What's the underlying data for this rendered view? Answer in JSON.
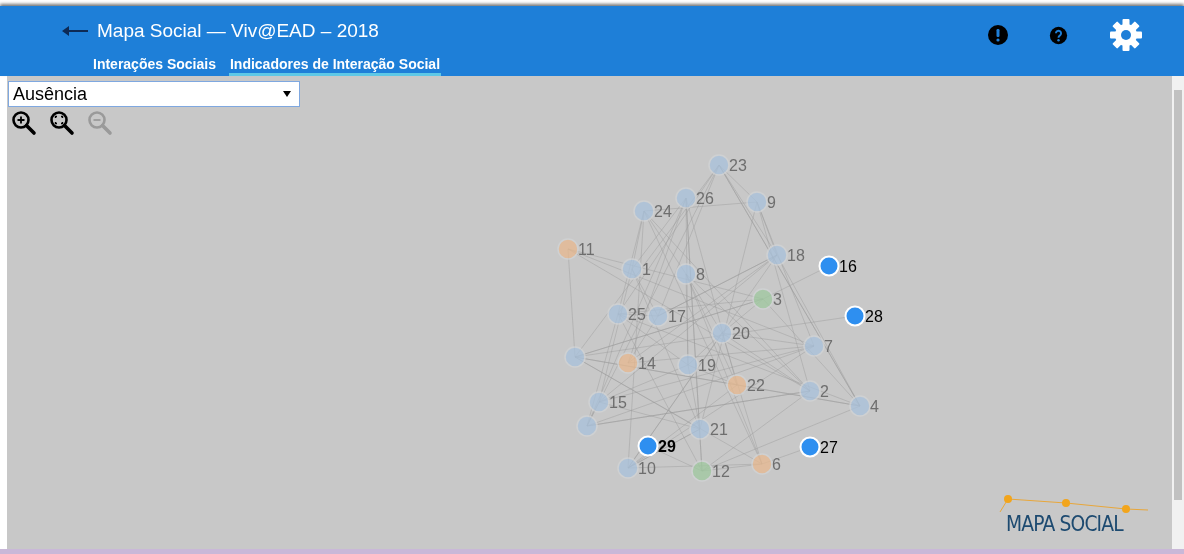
{
  "header": {
    "title": "Mapa Social — Viv@EAD – 2018"
  },
  "tabs": [
    {
      "label": "Interações Sociais",
      "selected": false
    },
    {
      "label": "Indicadores de Interação Social",
      "selected": true
    }
  ],
  "indicator_select": {
    "value": "Ausência"
  },
  "zoom_tools": [
    {
      "kind": "in",
      "disabled": false
    },
    {
      "kind": "reset",
      "disabled": false
    },
    {
      "kind": "out",
      "disabled": true
    }
  ],
  "graph": {
    "nodes": [
      {
        "label": "23",
        "color": "#a9c2dc",
        "highlighted": false
      },
      {
        "label": "26",
        "color": "#a9c2dc",
        "highlighted": false
      },
      {
        "label": "9",
        "color": "#a9c2dc",
        "highlighted": false
      },
      {
        "label": "24",
        "color": "#a9c2dc",
        "highlighted": false
      },
      {
        "label": "11",
        "color": "#e8b98f",
        "highlighted": false
      },
      {
        "label": "18",
        "color": "#a9c2dc",
        "highlighted": false
      },
      {
        "label": "16",
        "color": "#2e8ff0",
        "highlighted": true
      },
      {
        "label": "1",
        "color": "#a9c2dc",
        "highlighted": false
      },
      {
        "label": "8",
        "color": "#a9c2dc",
        "highlighted": false
      },
      {
        "label": "3",
        "color": "#9fc99f",
        "highlighted": false
      },
      {
        "label": "25",
        "color": "#a9c2dc",
        "highlighted": false
      },
      {
        "label": "17",
        "color": "#a9c2dc",
        "highlighted": false
      },
      {
        "label": "28",
        "color": "#2e8ff0",
        "highlighted": true
      },
      {
        "label": "20",
        "color": "#a9c2dc",
        "highlighted": false
      },
      {
        "label": "7",
        "color": "#a9c2dc",
        "highlighted": false
      },
      {
        "color": "#a9c2dc",
        "highlighted": false
      },
      {
        "label": "14",
        "color": "#e8b98f",
        "highlighted": false
      },
      {
        "label": "19",
        "color": "#a9c2dc",
        "highlighted": false
      },
      {
        "label": "22",
        "color": "#e8b98f",
        "highlighted": false
      },
      {
        "label": "2",
        "color": "#a9c2dc",
        "highlighted": false
      },
      {
        "label": "4",
        "color": "#a9c2dc",
        "highlighted": false
      },
      {
        "label": "15",
        "color": "#a9c2dc",
        "highlighted": false
      },
      {
        "color": "#a9c2dc",
        "highlighted": false
      },
      {
        "label": "21",
        "color": "#a9c2dc",
        "highlighted": false
      },
      {
        "label": "29",
        "color": "#2e8ff0",
        "highlighted": true,
        "bold": true
      },
      {
        "label": "27",
        "color": "#2e8ff0",
        "highlighted": true
      },
      {
        "label": "10",
        "color": "#a9c2dc",
        "highlighted": false
      },
      {
        "label": "12",
        "color": "#9fc99f",
        "highlighted": false
      },
      {
        "label": "6",
        "color": "#e8b98f",
        "highlighted": false
      }
    ]
  },
  "logo": {
    "text": "MAPA SOCIAL"
  }
}
